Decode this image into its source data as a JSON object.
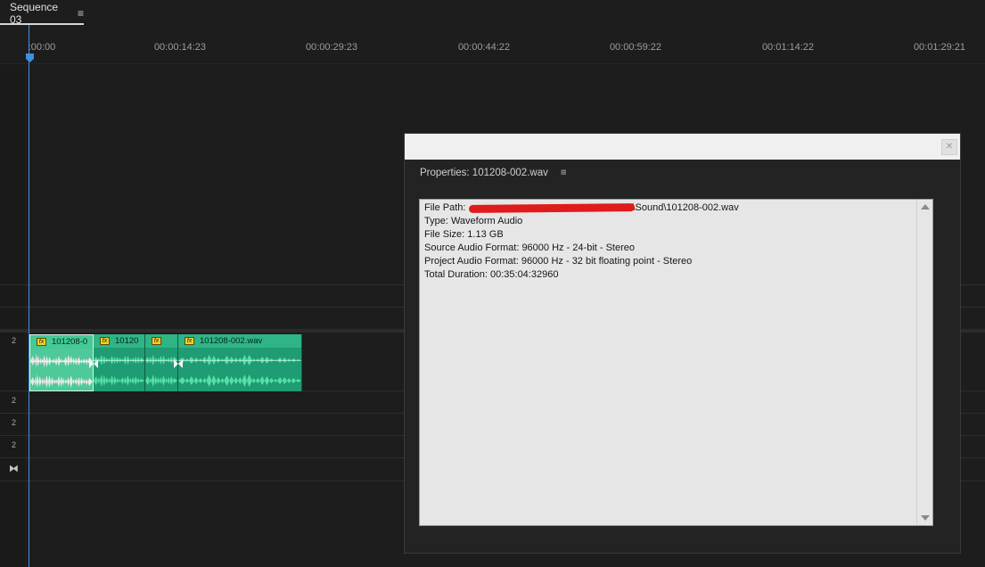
{
  "sequence_tab": {
    "label": "Sequence 03",
    "menu_icon": "hamburger-icon"
  },
  "ruler": {
    "timecodes": [
      ":00:00",
      "00:00:14:23",
      "00:00:29:23",
      "00:00:44:22",
      "00:00:59:22",
      "00:01:14:22",
      "00:01:29:21"
    ]
  },
  "tracks": {
    "labels": [
      "2",
      "2",
      "2",
      "2"
    ],
    "end_icon": "bowtie-icon"
  },
  "clips": [
    {
      "name": "101208-0"
    },
    {
      "name": "10120"
    },
    {
      "name": ""
    },
    {
      "name": "101208-002.wav"
    }
  ],
  "properties_dialog": {
    "panel_title": "Properties: 101208-002.wav",
    "menu_icon": "hamburger-icon",
    "close_icon": "close-icon",
    "lines": {
      "file_path": "File Path:",
      "file_path_suffix": "\\Sound\\101208-002.wav",
      "type": "Type: Waveform Audio",
      "file_size": "File Size: 1.13 GB",
      "source_format": "Source Audio Format: 96000 Hz - 24-bit - Stereo",
      "project_format": "Project Audio Format: 96000 Hz - 32 bit floating point - Stereo",
      "total_duration": "Total Duration: 00:35:04:32960"
    }
  },
  "colors": {
    "background": "#1d1d1d",
    "playhead": "#3d8fe0",
    "clip_green": "#1f9c73",
    "clip_selected": "#4fc99a",
    "redaction": "#e01b1b"
  }
}
